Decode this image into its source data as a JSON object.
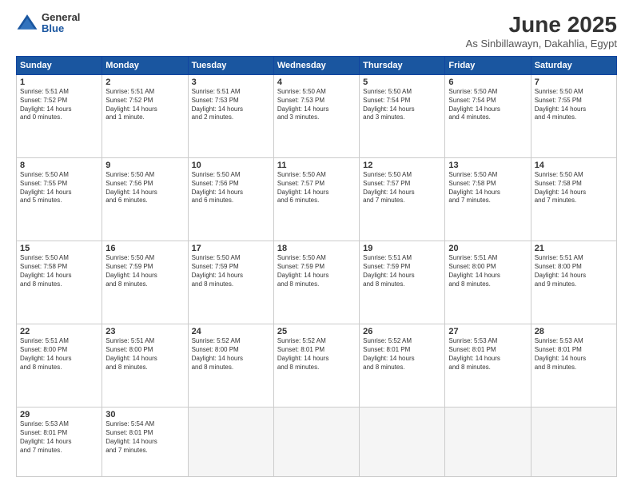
{
  "logo": {
    "general": "General",
    "blue": "Blue"
  },
  "title": "June 2025",
  "location": "As Sinbillawayn, Dakahlia, Egypt",
  "days_header": [
    "Sunday",
    "Monday",
    "Tuesday",
    "Wednesday",
    "Thursday",
    "Friday",
    "Saturday"
  ],
  "weeks": [
    [
      {
        "day": "1",
        "info": "Sunrise: 5:51 AM\nSunset: 7:52 PM\nDaylight: 14 hours\nand 0 minutes."
      },
      {
        "day": "2",
        "info": "Sunrise: 5:51 AM\nSunset: 7:52 PM\nDaylight: 14 hours\nand 1 minute."
      },
      {
        "day": "3",
        "info": "Sunrise: 5:51 AM\nSunset: 7:53 PM\nDaylight: 14 hours\nand 2 minutes."
      },
      {
        "day": "4",
        "info": "Sunrise: 5:50 AM\nSunset: 7:53 PM\nDaylight: 14 hours\nand 3 minutes."
      },
      {
        "day": "5",
        "info": "Sunrise: 5:50 AM\nSunset: 7:54 PM\nDaylight: 14 hours\nand 3 minutes."
      },
      {
        "day": "6",
        "info": "Sunrise: 5:50 AM\nSunset: 7:54 PM\nDaylight: 14 hours\nand 4 minutes."
      },
      {
        "day": "7",
        "info": "Sunrise: 5:50 AM\nSunset: 7:55 PM\nDaylight: 14 hours\nand 4 minutes."
      }
    ],
    [
      {
        "day": "8",
        "info": "Sunrise: 5:50 AM\nSunset: 7:55 PM\nDaylight: 14 hours\nand 5 minutes."
      },
      {
        "day": "9",
        "info": "Sunrise: 5:50 AM\nSunset: 7:56 PM\nDaylight: 14 hours\nand 6 minutes."
      },
      {
        "day": "10",
        "info": "Sunrise: 5:50 AM\nSunset: 7:56 PM\nDaylight: 14 hours\nand 6 minutes."
      },
      {
        "day": "11",
        "info": "Sunrise: 5:50 AM\nSunset: 7:57 PM\nDaylight: 14 hours\nand 6 minutes."
      },
      {
        "day": "12",
        "info": "Sunrise: 5:50 AM\nSunset: 7:57 PM\nDaylight: 14 hours\nand 7 minutes."
      },
      {
        "day": "13",
        "info": "Sunrise: 5:50 AM\nSunset: 7:58 PM\nDaylight: 14 hours\nand 7 minutes."
      },
      {
        "day": "14",
        "info": "Sunrise: 5:50 AM\nSunset: 7:58 PM\nDaylight: 14 hours\nand 7 minutes."
      }
    ],
    [
      {
        "day": "15",
        "info": "Sunrise: 5:50 AM\nSunset: 7:58 PM\nDaylight: 14 hours\nand 8 minutes."
      },
      {
        "day": "16",
        "info": "Sunrise: 5:50 AM\nSunset: 7:59 PM\nDaylight: 14 hours\nand 8 minutes."
      },
      {
        "day": "17",
        "info": "Sunrise: 5:50 AM\nSunset: 7:59 PM\nDaylight: 14 hours\nand 8 minutes."
      },
      {
        "day": "18",
        "info": "Sunrise: 5:50 AM\nSunset: 7:59 PM\nDaylight: 14 hours\nand 8 minutes."
      },
      {
        "day": "19",
        "info": "Sunrise: 5:51 AM\nSunset: 7:59 PM\nDaylight: 14 hours\nand 8 minutes."
      },
      {
        "day": "20",
        "info": "Sunrise: 5:51 AM\nSunset: 8:00 PM\nDaylight: 14 hours\nand 8 minutes."
      },
      {
        "day": "21",
        "info": "Sunrise: 5:51 AM\nSunset: 8:00 PM\nDaylight: 14 hours\nand 9 minutes."
      }
    ],
    [
      {
        "day": "22",
        "info": "Sunrise: 5:51 AM\nSunset: 8:00 PM\nDaylight: 14 hours\nand 8 minutes."
      },
      {
        "day": "23",
        "info": "Sunrise: 5:51 AM\nSunset: 8:00 PM\nDaylight: 14 hours\nand 8 minutes."
      },
      {
        "day": "24",
        "info": "Sunrise: 5:52 AM\nSunset: 8:00 PM\nDaylight: 14 hours\nand 8 minutes."
      },
      {
        "day": "25",
        "info": "Sunrise: 5:52 AM\nSunset: 8:01 PM\nDaylight: 14 hours\nand 8 minutes."
      },
      {
        "day": "26",
        "info": "Sunrise: 5:52 AM\nSunset: 8:01 PM\nDaylight: 14 hours\nand 8 minutes."
      },
      {
        "day": "27",
        "info": "Sunrise: 5:53 AM\nSunset: 8:01 PM\nDaylight: 14 hours\nand 8 minutes."
      },
      {
        "day": "28",
        "info": "Sunrise: 5:53 AM\nSunset: 8:01 PM\nDaylight: 14 hours\nand 8 minutes."
      }
    ],
    [
      {
        "day": "29",
        "info": "Sunrise: 5:53 AM\nSunset: 8:01 PM\nDaylight: 14 hours\nand 7 minutes."
      },
      {
        "day": "30",
        "info": "Sunrise: 5:54 AM\nSunset: 8:01 PM\nDaylight: 14 hours\nand 7 minutes."
      },
      {
        "day": "",
        "info": ""
      },
      {
        "day": "",
        "info": ""
      },
      {
        "day": "",
        "info": ""
      },
      {
        "day": "",
        "info": ""
      },
      {
        "day": "",
        "info": ""
      }
    ]
  ]
}
